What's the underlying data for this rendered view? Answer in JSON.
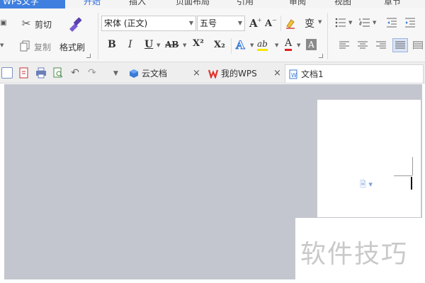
{
  "menu": {
    "file": "WPS文字",
    "tabs": [
      "开始",
      "插入",
      "页面布局",
      "引用",
      "审阅",
      "视图",
      "章节"
    ],
    "active_tab": 0
  },
  "ribbon": {
    "cut": "剪切",
    "copy": "复制",
    "format_painter": "格式刷",
    "font_name": "宋体 (正文)",
    "font_size": "五号",
    "bold": "B",
    "italic": "I",
    "underline": "U",
    "strikethrough": "AB",
    "superscript": "X²",
    "subscript": "X₂",
    "grow_font": "A",
    "shrink_font": "A",
    "wen": "变",
    "text_effect": "A",
    "highlight": "ab",
    "font_color": "A",
    "char_shading": "A"
  },
  "tabs": [
    {
      "label": "云文档",
      "closable": true,
      "active": false
    },
    {
      "label": "我的WPS",
      "closable": true,
      "active": false
    },
    {
      "label": "文档1",
      "closable": false,
      "active": true
    }
  ],
  "watermark": "软件技巧",
  "colors": {
    "accent": "#2f6fdf",
    "file_button": "#3f7fe0",
    "workspace": "#c4c6cf",
    "wps_red": "#e0322a"
  }
}
